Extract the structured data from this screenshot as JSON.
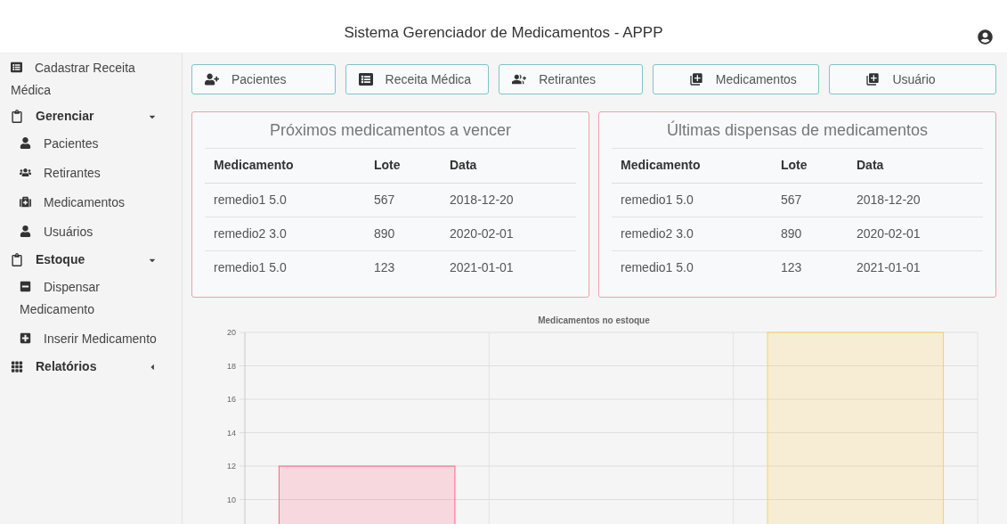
{
  "header": {
    "title": "Sistema Gerenciador de Medicamentos - APPP"
  },
  "sidebar": {
    "items": [
      {
        "label": "Cadastrar Receita Médica"
      },
      {
        "label": "Gerenciar",
        "expanded": true,
        "children": [
          {
            "label": "Pacientes"
          },
          {
            "label": "Retirantes"
          },
          {
            "label": "Medicamentos"
          },
          {
            "label": "Usuários"
          }
        ]
      },
      {
        "label": "Estoque",
        "expanded": true,
        "children": [
          {
            "label": "Dispensar Medicamento"
          },
          {
            "label": "Inserir Medicamento"
          }
        ]
      },
      {
        "label": "Relatórios",
        "expanded": false
      }
    ]
  },
  "shortcuts": [
    {
      "label": "Pacientes"
    },
    {
      "label": "Receita Médica"
    },
    {
      "label": "Retirantes"
    },
    {
      "label": "Medicamentos"
    },
    {
      "label": "Usuário"
    }
  ],
  "tables": [
    {
      "title": "Próximos medicamentos a vencer",
      "columns": [
        "Medicamento",
        "Lote",
        "Data"
      ],
      "rows": [
        [
          "remedio1 5.0",
          "567",
          "2018-12-20"
        ],
        [
          "remedio2 3.0",
          "890",
          "2020-02-01"
        ],
        [
          "remedio1 5.0",
          "123",
          "2021-01-01"
        ]
      ]
    },
    {
      "title": "Últimas dispensas de medicamentos",
      "columns": [
        "Medicamento",
        "Lote",
        "Data"
      ],
      "rows": [
        [
          "remedio1 5.0",
          "567",
          "2018-12-20"
        ],
        [
          "remedio2 3.0",
          "890",
          "2020-02-01"
        ],
        [
          "remedio1 5.0",
          "123",
          "2021-01-01"
        ]
      ]
    }
  ],
  "chart": {
    "chart_data": {
      "type": "bar",
      "title": "Medicamentos no estoque",
      "categories": [
        null,
        null,
        null
      ],
      "series": [
        {
          "color": "#ff6384",
          "values": [
            12,
            null,
            null
          ]
        },
        {
          "color": "#ffce56",
          "values": [
            null,
            null,
            20
          ]
        }
      ],
      "grid": true,
      "ylim": [
        0,
        20
      ],
      "yticks": [
        10,
        12,
        14,
        16,
        18,
        20
      ]
    }
  }
}
